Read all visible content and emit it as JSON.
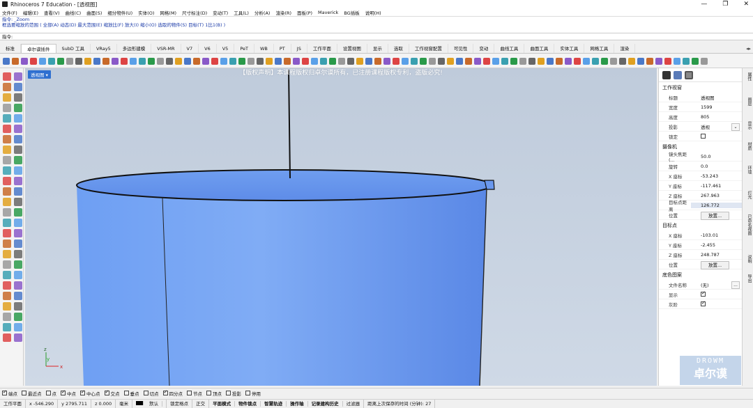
{
  "window": {
    "title": "Rhinoceros 7 Education - [透视图]",
    "controls": [
      "—",
      "❐",
      "✕"
    ]
  },
  "menu": [
    "文件(F)",
    "编辑(E)",
    "查看(V)",
    "曲线(C)",
    "曲面(S)",
    "细分物件(U)",
    "实体(O)",
    "网格(M)",
    "尺寸标注(D)",
    "变动(T)",
    "工具(L)",
    "分析(A)",
    "渲染(R)",
    "面板(P)",
    "Maverick",
    "BG插板",
    "说明(H)"
  ],
  "history": [
    "指令: _Zoom",
    "框选要缩放的范围 ( 全部(A) 动态(D) 最大范围(E) 缩放比(F) 放大(I) 缩小(O) 选取的物件(S) 目标(T) 1比1(B) )"
  ],
  "command_prompt": "指令:",
  "tabs": [
    "标准",
    "卓尔谟插件",
    "SubD 工具",
    "VRay5",
    "多边形建模",
    "VSR-MR",
    "V7",
    "V6",
    "V5",
    "PeT",
    "WB",
    "PT",
    "JS",
    "工作平面",
    "设置视图",
    "显示",
    "选取",
    "工作视窗配置",
    "可见性",
    "变动",
    "曲线工具",
    "曲面工具",
    "实体工具",
    "网格工具",
    "渲染"
  ],
  "tab_scroll": "◂▸",
  "viewport": {
    "label": "透视图 ▾",
    "notice": "【版权声明】本课程版权归卓尔谟所有，已注册课程版权专利，盗版必究!",
    "axes": {
      "x": "x",
      "y": "y",
      "z": "z"
    }
  },
  "panel": {
    "sections": {
      "viewport": "工作视窗",
      "camera": "摄像机",
      "target": "目标点",
      "wallpaper": "底色图案"
    },
    "viewport_rows": [
      {
        "k": "标题",
        "v": "透视图"
      },
      {
        "k": "宽度",
        "v": "1599"
      },
      {
        "k": "高度",
        "v": "805"
      },
      {
        "k": "投影",
        "v": "透视"
      },
      {
        "k": "锁定",
        "v": ""
      }
    ],
    "camera_rows": [
      {
        "k": "镜头焦距(...",
        "v": "50.0"
      },
      {
        "k": "旋转",
        "v": "0.0"
      },
      {
        "k": "X 座标",
        "v": "-53.243"
      },
      {
        "k": "Y 座标",
        "v": "-117.461"
      },
      {
        "k": "Z 座标",
        "v": "267.963"
      },
      {
        "k": "目标点距离",
        "v": "126.772"
      },
      {
        "k": "位置",
        "v": "放置..."
      }
    ],
    "target_rows": [
      {
        "k": "X 座标",
        "v": "-103.01"
      },
      {
        "k": "Y 座标",
        "v": "-2.455"
      },
      {
        "k": "Z 座标",
        "v": "248.787"
      },
      {
        "k": "位置",
        "v": "放置..."
      }
    ],
    "wallpaper_rows": [
      {
        "k": "文件名称",
        "v": "(无)"
      },
      {
        "k": "显示",
        "v": ""
      },
      {
        "k": "灰阶",
        "v": ""
      }
    ],
    "browse": "..."
  },
  "side_tabs": [
    "属性",
    "图层",
    "显示",
    "材质",
    "环境",
    "灯光",
    "已命名视图",
    "说明",
    "导出"
  ],
  "watermark": {
    "line1": "DROWM",
    "line2": "卓尔谟"
  },
  "osnap": [
    {
      "label": "端点",
      "on": true
    },
    {
      "label": "最近点",
      "on": false
    },
    {
      "label": "点",
      "on": false
    },
    {
      "label": "中点",
      "on": true
    },
    {
      "label": "中心点",
      "on": true
    },
    {
      "label": "交点",
      "on": true
    },
    {
      "label": "垂点",
      "on": false
    },
    {
      "label": "切点",
      "on": false
    },
    {
      "label": "四分点",
      "on": true
    },
    {
      "label": "节点",
      "on": false
    },
    {
      "label": "顶点",
      "on": false
    },
    {
      "label": "投影",
      "on": false
    },
    {
      "label": "停用",
      "on": false
    }
  ],
  "status": {
    "plane": "工作平面",
    "x": "x -546.290",
    "y": "y 2795.711",
    "z": "z 0.000",
    "unit": "毫米",
    "layer": "默认",
    "toggles": [
      "锁定格点",
      "正交",
      "平面模式",
      "物件锁点",
      "智慧轨迹",
      "操作轴",
      "记录建构历史",
      "过滤器"
    ],
    "autosave": "距离上次保存的时间 (分钟): 27"
  },
  "colors": {
    "surface": "#7ba8f2",
    "surface_dark": "#4f7fe0",
    "viewport_bg": "#c6d2e1",
    "label_bg": "#2e6fd0",
    "highlight": "#dfe6f2"
  }
}
